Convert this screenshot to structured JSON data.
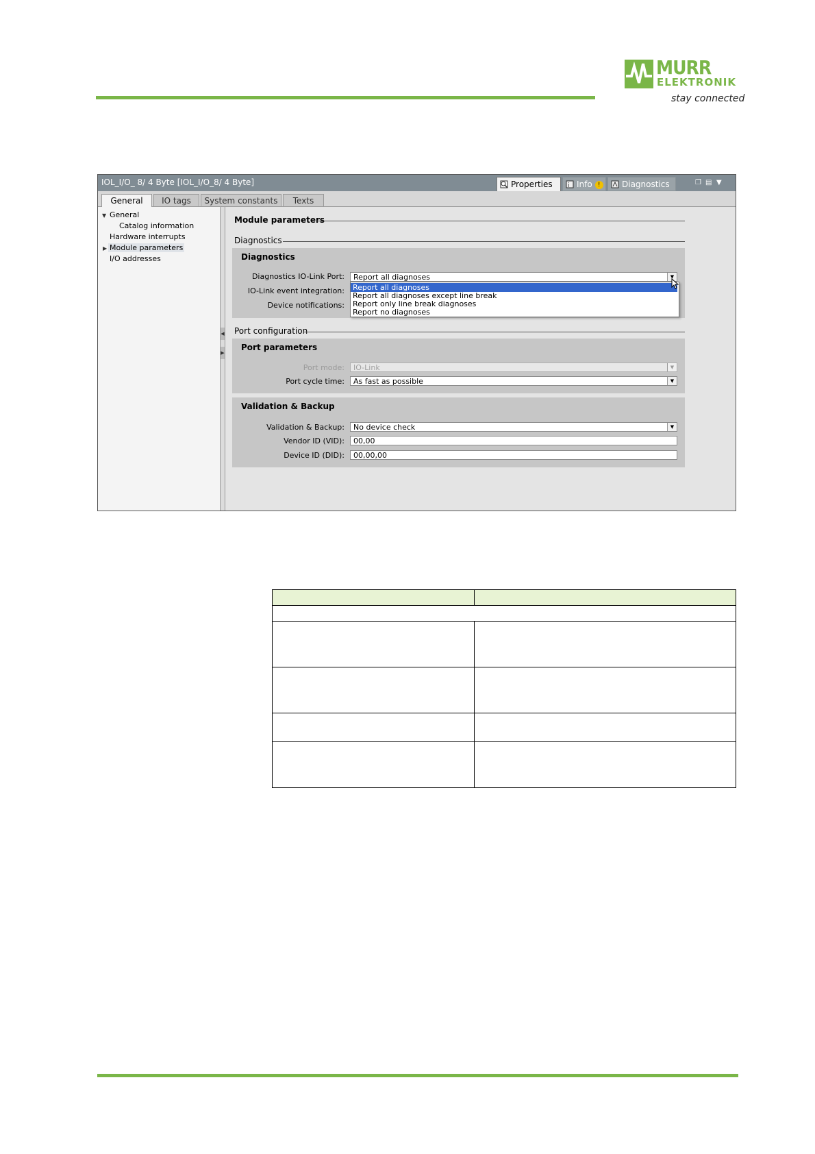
{
  "header": {
    "logo_line1": "MURR",
    "logo_line2": "ELEKTRONIK",
    "logo_tagline": "stay connected",
    "accent_color": "#7ab648"
  },
  "window": {
    "title": "IOL_I/O_ 8/ 4 Byte [IOL_I/O_8/ 4 Byte]",
    "panel_tabs": [
      {
        "label": "Properties",
        "icon": "properties-icon",
        "active": true
      },
      {
        "label": "Info",
        "icon": "info-icon",
        "active": false
      },
      {
        "label": "Diagnostics",
        "icon": "diagnostics-icon",
        "active": false
      }
    ],
    "tabs": [
      "General",
      "IO tags",
      "System constants",
      "Texts"
    ],
    "tree": [
      {
        "label": "General",
        "expanded": true
      },
      {
        "label": "Catalog information"
      },
      {
        "label": "Hardware interrupts"
      },
      {
        "label": "Module parameters",
        "selected": true
      },
      {
        "label": "I/O addresses"
      }
    ],
    "sections": {
      "module_parameters": "Module parameters",
      "diagnostics_header": "Diagnostics",
      "port_configuration": "Port configuration"
    },
    "diagnostics_group": {
      "title": "Diagnostics",
      "diag_port_label": "Diagnostics IO-Link Port:",
      "diag_port_value": "Report all diagnoses",
      "event_integration_label": "IO-Link event integration:",
      "device_notifications_label": "Device notifications:",
      "dropdown_options": [
        "Report all diagnoses",
        "Report all diagnoses except line break",
        "Report only line break diagnoses",
        "Report no diagnoses"
      ],
      "highlighted_option": 0
    },
    "port_group": {
      "title": "Port parameters",
      "port_mode_label": "Port mode:",
      "port_mode_value": "IO-Link",
      "cycle_time_label": "Port cycle time:",
      "cycle_time_value": "As fast as possible"
    },
    "validation_group": {
      "title": "Validation & Backup",
      "validation_label": "Validation & Backup:",
      "validation_value": "No device check",
      "vendor_label": "Vendor ID (VID):",
      "vendor_value": "00,00",
      "device_label": "Device ID (DID):",
      "device_value": "00,00,00"
    }
  },
  "table": {
    "header_color": "#e8f3d4"
  }
}
